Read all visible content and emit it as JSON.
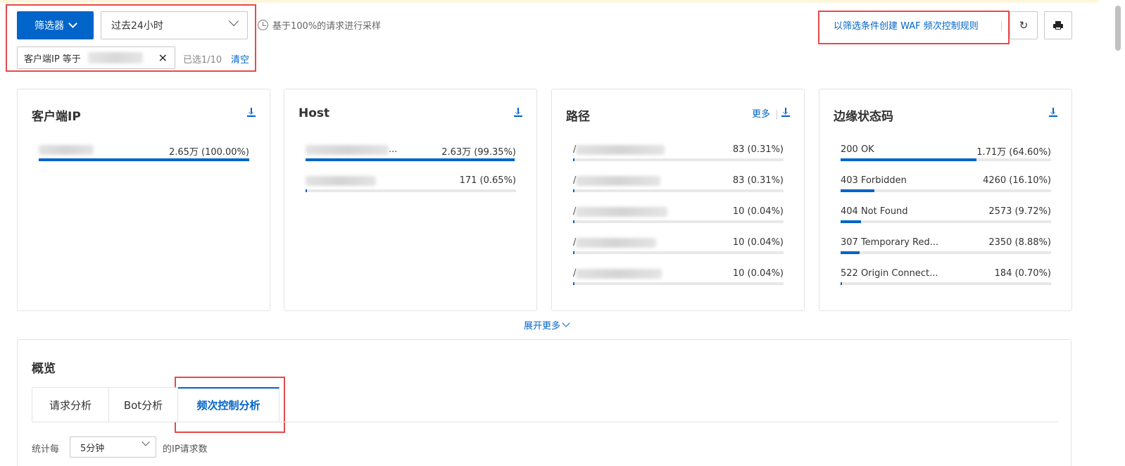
{
  "toolbar": {
    "filter_label": "筛选器",
    "time_range": "过去24小时",
    "sampling_note": "基于100%的请求进行采样",
    "chip_label": "客户端IP  等于",
    "selected_count": "已选1/10",
    "clear_label": "清空",
    "waf_link": "以筛选条件创建 WAF 频次控制规则"
  },
  "cards": [
    {
      "title": "客户端IP",
      "rows": [
        {
          "label": "",
          "value": "2.65万 (100.00%)",
          "fraction": 1.0
        }
      ]
    },
    {
      "title": "Host",
      "rows": [
        {
          "label": "...",
          "value": "2.63万 (99.35%)",
          "fraction": 0.9935
        },
        {
          "label": "",
          "value": "171 (0.65%)",
          "fraction": 0.0065
        }
      ]
    },
    {
      "title": "路径",
      "more": "更多",
      "rows": [
        {
          "label": "/",
          "value": "83 (0.31%)",
          "fraction": 0.0031
        },
        {
          "label": "/",
          "value": "83 (0.31%)",
          "fraction": 0.0031
        },
        {
          "label": "/",
          "value": "10 (0.04%)",
          "fraction": 0.0004
        },
        {
          "label": "/",
          "value": "10 (0.04%)",
          "fraction": 0.0004
        },
        {
          "label": "/",
          "value": "10 (0.04%)",
          "fraction": 0.0004
        }
      ]
    },
    {
      "title": "边缘状态码",
      "rows": [
        {
          "label": "200 OK",
          "value": "1.71万 (64.60%)",
          "fraction": 0.646
        },
        {
          "label": "403 Forbidden",
          "value": "4260 (16.10%)",
          "fraction": 0.161
        },
        {
          "label": "404 Not Found",
          "value": "2573 (9.72%)",
          "fraction": 0.0972
        },
        {
          "label": "307 Temporary Red...",
          "value": "2350 (8.88%)",
          "fraction": 0.0888
        },
        {
          "label": "522 Origin Connect...",
          "value": "184 (0.70%)",
          "fraction": 0.007
        }
      ]
    }
  ],
  "expand_more": "展开更多",
  "overview": {
    "title": "概览",
    "tabs": [
      {
        "label": "请求分析"
      },
      {
        "label": "Bot分析"
      },
      {
        "label": "频次控制分析"
      }
    ],
    "stat_prefix": "统计每",
    "stat_interval": "5分钟",
    "stat_suffix": "的IP请求数"
  },
  "colors": {
    "accent": "#0064c8",
    "highlight_box": "#e8484b",
    "bar_track": "#e8e8e8"
  }
}
